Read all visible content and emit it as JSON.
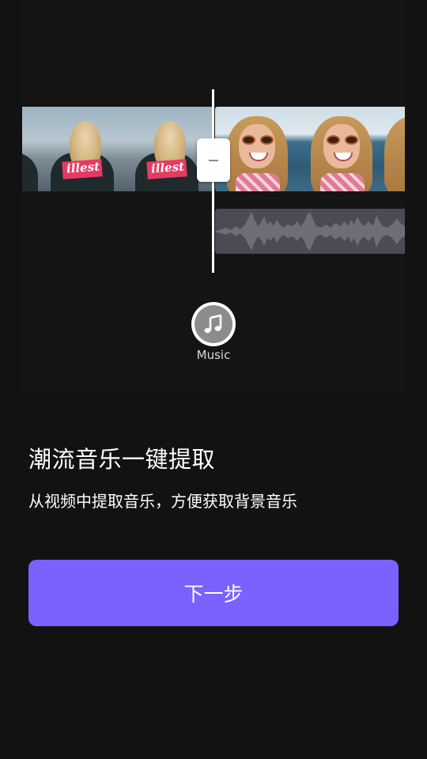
{
  "preview": {
    "music_label": "Music",
    "music_icon": "music-note-icon"
  },
  "content": {
    "headline": "潮流音乐一键提取",
    "subline": "从视频中提取音乐，方便获取背景音乐"
  },
  "actions": {
    "next_label": "下一步"
  },
  "colors": {
    "background": "#121212",
    "accent": "#7b61ff",
    "audio_track": "#4b4b55",
    "waveform": "#6e6e78"
  }
}
